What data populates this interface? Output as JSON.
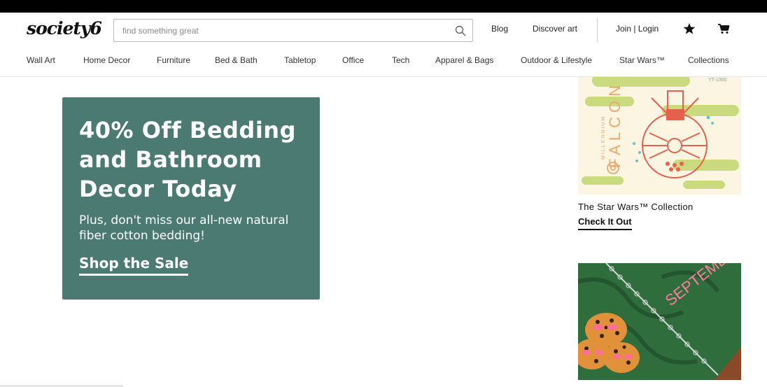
{
  "header": {
    "logo": "society6",
    "search": {
      "placeholder": "find something great",
      "value": ""
    },
    "links": {
      "blog": "Blog",
      "discover": "Discover art",
      "login": "Join | Login"
    },
    "icons": {
      "search": "search-icon",
      "favorites": "star-icon",
      "cart": "cart-icon"
    }
  },
  "nav": {
    "items": [
      {
        "label": "Wall Art"
      },
      {
        "label": "Home Decor"
      },
      {
        "label": "Furniture"
      },
      {
        "label": "Bed & Bath"
      },
      {
        "label": "Tabletop"
      },
      {
        "label": "Office"
      },
      {
        "label": "Tech"
      },
      {
        "label": "Apparel & Bags"
      },
      {
        "label": "Outdoor & Lifestyle"
      },
      {
        "label": "Star Wars™"
      },
      {
        "label": "Collections"
      }
    ]
  },
  "promo": {
    "title": "40% Off Bedding and Bathroom Decor Today",
    "subtitle": "Plus, don't miss our all-new natural fiber cotton bedding!",
    "cta": "Shop the Sale",
    "background_color": "#4a7a71"
  },
  "side": {
    "card1": {
      "image_text": "FALCON",
      "image_small_text": "MILLENNIUM",
      "image_code": "YT-1300",
      "title": "The Star Wars™ Collection",
      "link": "Check It Out"
    },
    "card2": {
      "image_text": "SEPTEMBER"
    }
  },
  "colors": {
    "accent": "#4a7a71",
    "text": "#222222",
    "topbar": "#000000"
  }
}
